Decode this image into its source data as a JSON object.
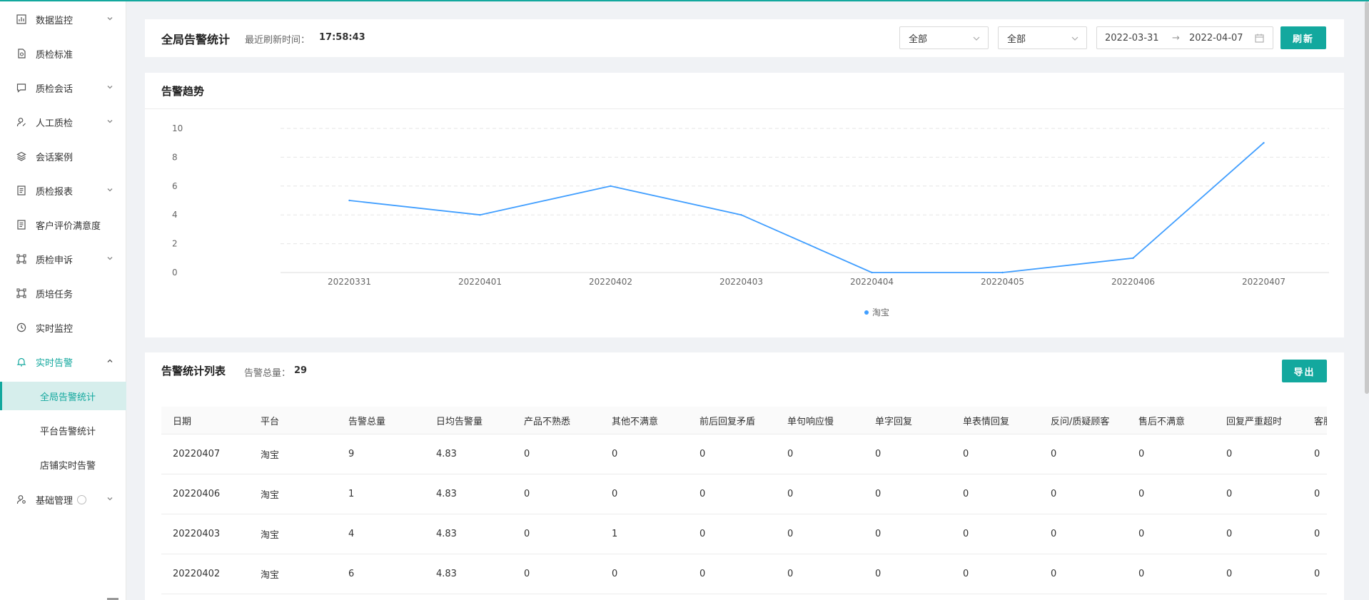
{
  "colors": {
    "accent": "#13a89e",
    "line": "#409eff",
    "active_bg": "#d6eeec"
  },
  "sidebar": {
    "items": [
      {
        "label": "数据监控",
        "icon": "bar-chart-icon",
        "has_children": true
      },
      {
        "label": "质检标准",
        "icon": "document-search-icon",
        "has_children": false
      },
      {
        "label": "质检会话",
        "icon": "chat-bubble-icon",
        "has_children": true
      },
      {
        "label": "人工质检",
        "icon": "user-edit-icon",
        "has_children": true
      },
      {
        "label": "会话案例",
        "icon": "layers-icon",
        "has_children": false
      },
      {
        "label": "质检报表",
        "icon": "report-icon",
        "has_children": true
      },
      {
        "label": "客户评价满意度",
        "icon": "report-icon",
        "has_children": false
      },
      {
        "label": "质检申诉",
        "icon": "frame-icon",
        "has_children": true
      },
      {
        "label": "质培任务",
        "icon": "frame-icon",
        "has_children": false
      },
      {
        "label": "实时监控",
        "icon": "clock-icon",
        "has_children": false
      },
      {
        "label": "实时告警",
        "icon": "bell-icon",
        "has_children": true,
        "open": true
      },
      {
        "label": "基础管理",
        "icon": "user-settings-icon",
        "has_children": true
      }
    ],
    "sub_items": [
      {
        "label": "全局告警统计",
        "active": true
      },
      {
        "label": "平台告警统计",
        "active": false
      },
      {
        "label": "店铺实时告警",
        "active": false
      }
    ]
  },
  "topbar": {
    "title": "全局告警统计",
    "refresh_label": "最近刷新时间：",
    "refresh_time": "17:58:43",
    "select1": "全部",
    "select2": "全部",
    "date_start": "2022-03-31",
    "date_sep": "→",
    "date_end": "2022-04-07",
    "refresh_button": "刷新"
  },
  "trend": {
    "title": "告警趋势"
  },
  "chart_data": {
    "type": "line",
    "title": "",
    "xlabel": "",
    "ylabel": "",
    "categories": [
      "20220331",
      "20220401",
      "20220402",
      "20220403",
      "20220404",
      "20220405",
      "20220406",
      "20220407"
    ],
    "series": [
      {
        "name": "淘宝",
        "values": [
          5,
          4,
          6,
          4,
          0,
          0,
          1,
          9
        ]
      }
    ],
    "ylim": [
      0,
      10
    ],
    "yticks": [
      0,
      2,
      4,
      6,
      8,
      10
    ],
    "grid": true,
    "legend": "bottom-center"
  },
  "table": {
    "title": "告警统计列表",
    "total_label": "告警总量：",
    "total_value": "29",
    "export_button": "导出",
    "columns": [
      "日期",
      "平台",
      "告警总量",
      "日均告警量",
      "产品不熟悉",
      "其他不满意",
      "前后回复矛盾",
      "单句响应慢",
      "单字回复",
      "单表情回复",
      "反问/质疑顾客",
      "售后不满意",
      "回复严重超时",
      "客服"
    ],
    "rows": [
      [
        "20220407",
        "淘宝",
        "9",
        "4.83",
        "0",
        "0",
        "0",
        "0",
        "0",
        "0",
        "0",
        "0",
        "0",
        "0"
      ],
      [
        "20220406",
        "淘宝",
        "1",
        "4.83",
        "0",
        "0",
        "0",
        "0",
        "0",
        "0",
        "0",
        "0",
        "0",
        "0"
      ],
      [
        "20220403",
        "淘宝",
        "4",
        "4.83",
        "0",
        "1",
        "0",
        "0",
        "0",
        "0",
        "0",
        "0",
        "0",
        "0"
      ],
      [
        "20220402",
        "淘宝",
        "6",
        "4.83",
        "0",
        "0",
        "0",
        "0",
        "0",
        "0",
        "0",
        "0",
        "0",
        "0"
      ]
    ]
  }
}
